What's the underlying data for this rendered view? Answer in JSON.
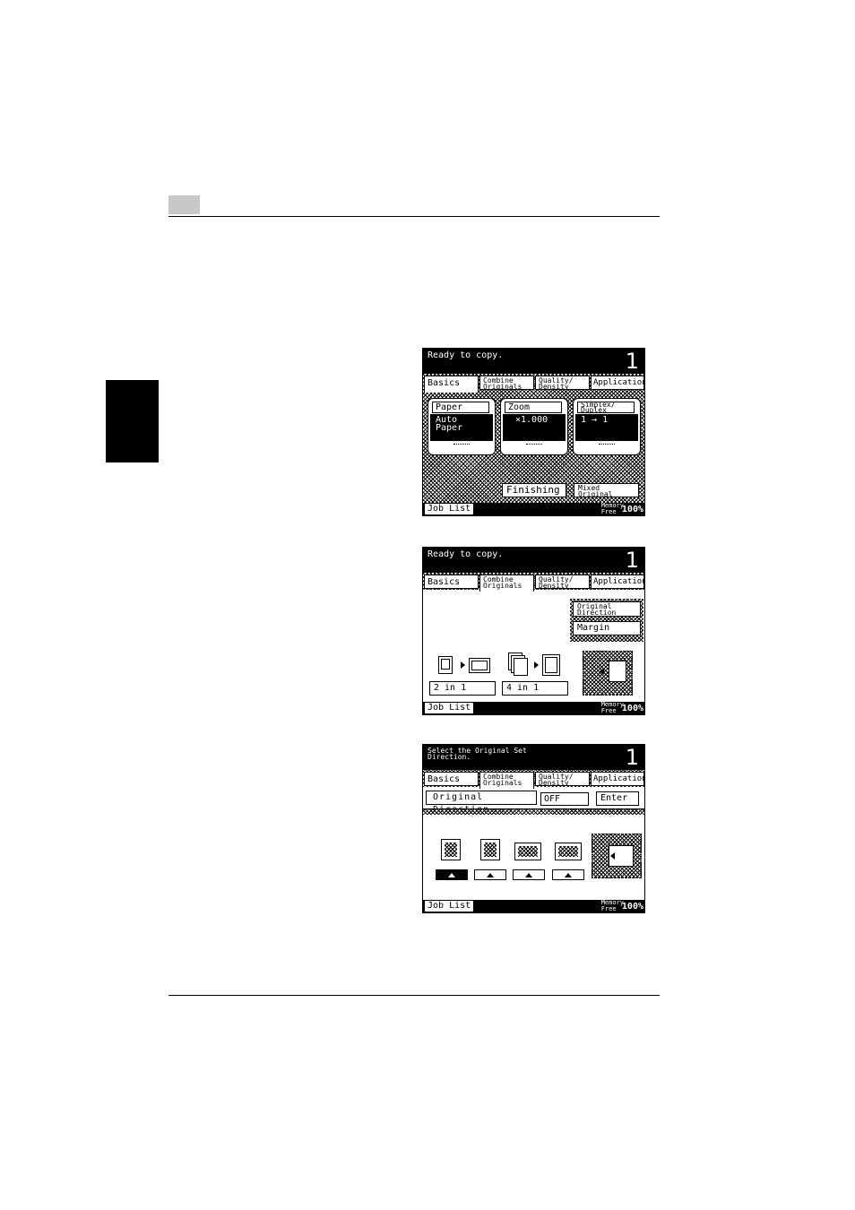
{
  "screens": [
    {
      "status": "Ready to copy.",
      "copies": "1",
      "tabs": [
        "Basics",
        "Combine\nOriginals",
        "Quality/\nDensity",
        "Application"
      ],
      "cards": [
        {
          "label": "Paper",
          "value": "Auto\nPaper"
        },
        {
          "label": "Zoom",
          "value": "×1.000"
        },
        {
          "label": "Simplex/\nDuplex",
          "value": "1 → 1"
        }
      ],
      "finishing": "Finishing",
      "mixed": "Mixed\nOriginal",
      "job_list": "Job List",
      "memory": "Memory\nFree",
      "memory_pct": "100%"
    },
    {
      "status": "Ready to copy.",
      "copies": "1",
      "tabs": [
        "Basics",
        "Combine\nOriginals",
        "Quality/\nDensity",
        "Application"
      ],
      "original_direction": "Original\nDirection",
      "margin": "Margin",
      "two_in_one": "2 in 1",
      "four_in_one": "4 in 1",
      "job_list": "Job List",
      "memory": "Memory\nFree",
      "memory_pct": "100%"
    },
    {
      "status": "Select the Original Set\nDirection.",
      "copies": "1",
      "tabs": [
        "Basics",
        "Combine\nOriginals",
        "Quality/\nDensity",
        "Application"
      ],
      "title": "Original Direction",
      "off": "OFF",
      "enter": "Enter",
      "job_list": "Job List",
      "memory": "Memory\nFree",
      "memory_pct": "100%"
    }
  ]
}
